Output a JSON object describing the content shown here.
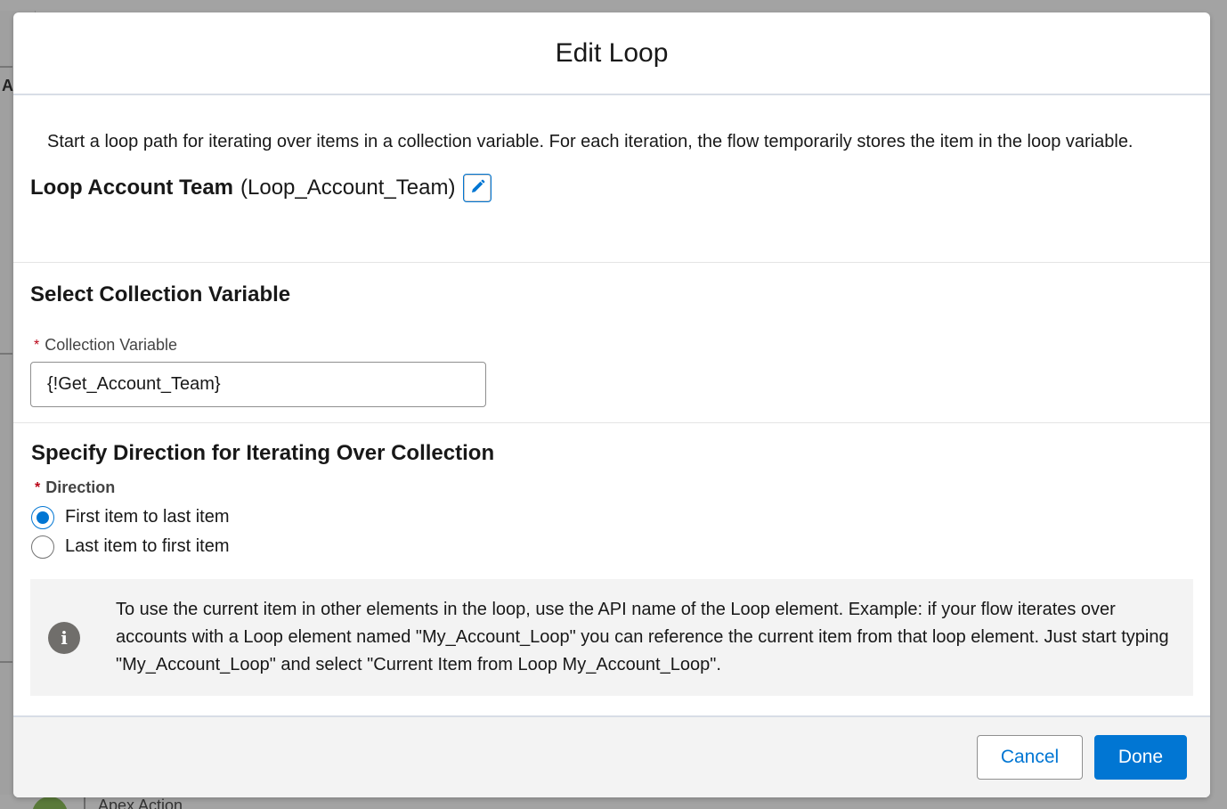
{
  "background": {
    "partial_letter": "A",
    "partial_item_label": "Apex Action"
  },
  "modal": {
    "title": "Edit Loop",
    "intro": "Start a loop path for iterating over items in a collection variable. For each iteration, the flow temporarily stores the item in the loop variable.",
    "element_label": "Loop Account Team",
    "element_api_name": "(Loop_Account_Team)",
    "edit_icon": "pencil-icon"
  },
  "collection": {
    "heading": "Select Collection Variable",
    "required_marker": "*",
    "field_label": "Collection Variable",
    "field_value": "{!Get_Account_Team}"
  },
  "direction": {
    "heading": "Specify Direction for Iterating Over Collection",
    "required_marker": "*",
    "field_label": "Direction",
    "options": [
      {
        "label": "First item to last item",
        "selected": true
      },
      {
        "label": "Last item to first item",
        "selected": false
      }
    ]
  },
  "info": {
    "icon": "info-icon",
    "glyph": "i",
    "text": "To use the current item in other elements in the loop, use the API name of the Loop element. Example: if your flow iterates over accounts with a Loop element named \"My_Account_Loop\" you can reference the current item from that loop element. Just start typing \"My_Account_Loop\" and select \"Current Item from Loop My_Account_Loop\"."
  },
  "footer": {
    "cancel_label": "Cancel",
    "done_label": "Done"
  },
  "colors": {
    "brand": "#0176d3",
    "required": "#ba0517",
    "info_icon": "#706e6b"
  }
}
